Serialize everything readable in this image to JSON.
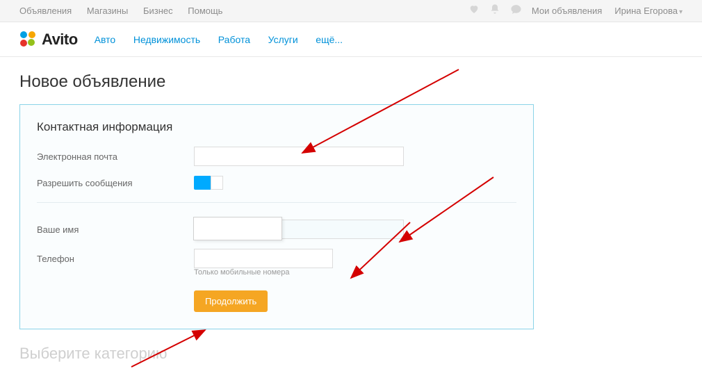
{
  "topbar": {
    "left": [
      "Объявления",
      "Магазины",
      "Бизнес",
      "Помощь"
    ],
    "my_ads": "Мои объявления",
    "user": "Ирина Егорова"
  },
  "logo_text": "Avito",
  "nav": [
    "Авто",
    "Недвижимость",
    "Работа",
    "Услуги",
    "ещё..."
  ],
  "page_title": "Новое объявление",
  "form": {
    "section": "Контактная информация",
    "email_label": "Электронная почта",
    "allow_msg_label": "Разрешить сообщения",
    "name_label": "Ваше имя",
    "phone_label": "Телефон",
    "phone_hint": "Только мобильные номера",
    "continue_btn": "Продолжить"
  },
  "footer_title": "Выберите категорию"
}
